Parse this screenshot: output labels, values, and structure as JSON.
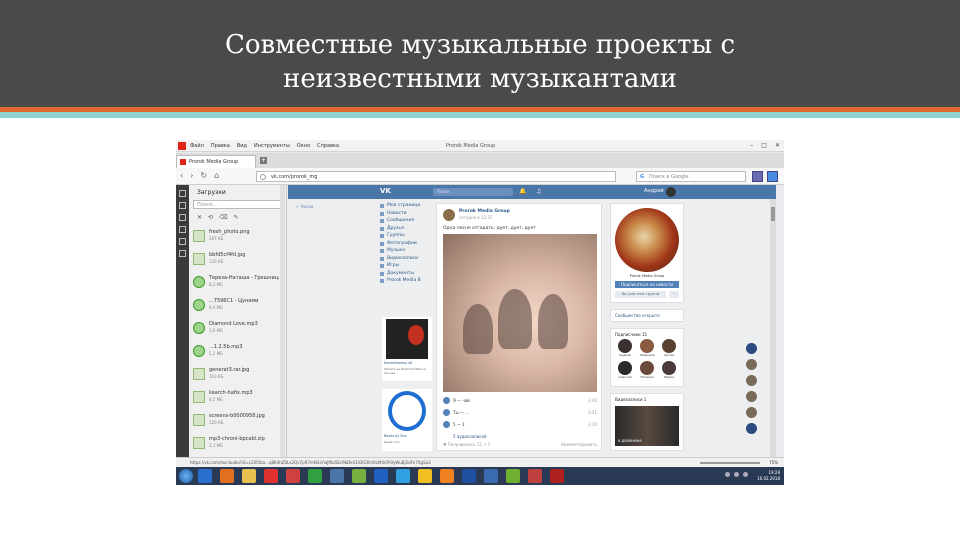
{
  "slide": {
    "title_line1": "Совместные музыкальные проекты с",
    "title_line2": "неизвестными музыкантами"
  },
  "browser": {
    "menu": [
      "Файл",
      "Правка",
      "Вид",
      "Инструменты",
      "Окно",
      "Справка"
    ],
    "window_title": "Prorok Media Group",
    "controls": [
      "–",
      "□",
      "✕"
    ],
    "tab_label": "Prorok Media Group",
    "tab_add": "+",
    "url": "vk.com/prorok_mg",
    "search_placeholder": "Поиск в Google",
    "search_engine": "G"
  },
  "downloads": {
    "title": "Загрузки",
    "search_placeholder": "Поиск...",
    "tools": [
      "✕",
      "⟲",
      "⌫",
      "✎"
    ],
    "items": [
      {
        "name": "fresh_photo.png",
        "size": "287 КБ",
        "green": false
      },
      {
        "name": "bbfd5cf4fd.jpg",
        "size": "126 КБ",
        "green": false
      },
      {
        "name": "Тереза-Наташа - Грешница",
        "size": "8,2 МБ",
        "green": true
      },
      {
        "name": "...7596С1 - Цунами",
        "size": "9,4 МБ",
        "green": true
      },
      {
        "name": "Diamond Love.mp3",
        "size": "3,6 МБ",
        "green": true
      },
      {
        "name": "...1.2.5b.mp3",
        "size": "5,2 МБ",
        "green": true
      },
      {
        "name": "generat3.rar.jpg",
        "size": "163 КБ",
        "green": false
      },
      {
        "name": "kearch-hafix.mp3",
        "size": "8,5 МБ",
        "green": false
      },
      {
        "name": "screens-b0000958.jpg",
        "size": "120 КБ",
        "green": false
      },
      {
        "name": "mp3-chroni-bpcabl.zip",
        "size": "2,1 МБ",
        "green": false
      }
    ]
  },
  "vk": {
    "logo": "VK",
    "search_placeholder": "Поиск",
    "bell": "🔔",
    "note": "♫",
    "username": "Андрей",
    "back_link": "← Назад",
    "menu": [
      "Моя страница",
      "Новости",
      "Сообщения",
      "Друзья",
      "Группы",
      "Фотографии",
      "Музыка",
      "Видеозаписи",
      "Игры",
      "Документы",
      "Prorok Media B"
    ],
    "ad1": {
      "title": "Nevertheless All",
      "subtitle": "Записи на Diamond Stars и прочее"
    },
    "ad2": {
      "title": "Beats by Dre",
      "subtitle": "beats.com"
    },
    "post": {
      "author": "Prorok Media Group",
      "date": "сегодня в 12:37",
      "text": "Одна песня отгадать: дует, дует, дует",
      "audio": [
        {
          "name": "Я — чай",
          "dur": "3:43"
        },
        {
          "name": "Ты — ...",
          "dur": "3:51"
        },
        {
          "name": "5 — 1",
          "dur": "3:10"
        }
      ],
      "link": "5 аудиозаписей",
      "footer_left": "♥ Понравилось 12   ↗ 1",
      "footer_right": "Комментировать"
    },
    "group": {
      "cover_caption": "Prorok Media Group",
      "join_button": "Подписаться на новости",
      "action_button": "Вы участник группы",
      "more_button": "···",
      "open_link": "Сообщество открыто",
      "friends_title": "Подписчики  15",
      "friends": [
        "Андрей",
        "Людмила",
        "Артём",
        "Алексей",
        "Наталья",
        "Мария"
      ],
      "video_title": "Видеозаписи  1",
      "video_caption": "К.ДЕВЯНИНА"
    }
  },
  "statusbar": {
    "url": "https://vk.com/doc/audio?id=c20f1ba...q8K4hZ0Lx2QvTpR7mN3sYwJf8a5Ec9bDkU1iOlG6hVtzM4nPr0yWuBj2dFe7XgSa3",
    "zoom": "75%"
  },
  "taskbar": {
    "tasks": [
      {
        "name": "ie-icon",
        "color": "#2a6ed0"
      },
      {
        "name": "firefox-icon",
        "color": "#e07020"
      },
      {
        "name": "folder-icon",
        "color": "#e8c050"
      },
      {
        "name": "yandex-icon",
        "color": "#e03030"
      },
      {
        "name": "vivaldi-icon",
        "color": "#d04040"
      },
      {
        "name": "chrome-icon",
        "color": "#30a040"
      },
      {
        "name": "vk-icon",
        "color": "#4a76a8"
      },
      {
        "name": "android-icon",
        "color": "#78b040"
      },
      {
        "name": "mail-icon",
        "color": "#2060c0"
      },
      {
        "name": "skype-icon",
        "color": "#30a0e0"
      },
      {
        "name": "yandex-browser-icon",
        "color": "#f0c020"
      },
      {
        "name": "ok-icon",
        "color": "#f08020"
      },
      {
        "name": "word-icon",
        "color": "#2050a0"
      },
      {
        "name": "vk-app-icon",
        "color": "#3a6ab0"
      },
      {
        "name": "utorrent-icon",
        "color": "#70b030"
      },
      {
        "name": "video-icon",
        "color": "#c04040"
      },
      {
        "name": "acrobat-icon",
        "color": "#b02020"
      }
    ],
    "time": "19:28",
    "date": "16.02.2018"
  }
}
